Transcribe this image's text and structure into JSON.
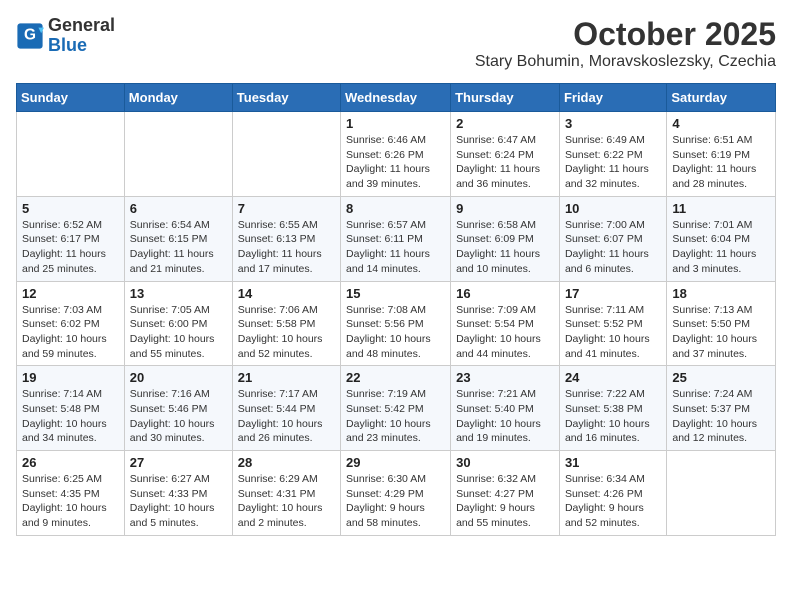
{
  "header": {
    "logo_general": "General",
    "logo_blue": "Blue",
    "title": "October 2025",
    "subtitle": "Stary Bohumin, Moravskoslezsky, Czechia"
  },
  "weekdays": [
    "Sunday",
    "Monday",
    "Tuesday",
    "Wednesday",
    "Thursday",
    "Friday",
    "Saturday"
  ],
  "weeks": [
    [
      {
        "day": "",
        "info": ""
      },
      {
        "day": "",
        "info": ""
      },
      {
        "day": "",
        "info": ""
      },
      {
        "day": "1",
        "info": "Sunrise: 6:46 AM\nSunset: 6:26 PM\nDaylight: 11 hours\nand 39 minutes."
      },
      {
        "day": "2",
        "info": "Sunrise: 6:47 AM\nSunset: 6:24 PM\nDaylight: 11 hours\nand 36 minutes."
      },
      {
        "day": "3",
        "info": "Sunrise: 6:49 AM\nSunset: 6:22 PM\nDaylight: 11 hours\nand 32 minutes."
      },
      {
        "day": "4",
        "info": "Sunrise: 6:51 AM\nSunset: 6:19 PM\nDaylight: 11 hours\nand 28 minutes."
      }
    ],
    [
      {
        "day": "5",
        "info": "Sunrise: 6:52 AM\nSunset: 6:17 PM\nDaylight: 11 hours\nand 25 minutes."
      },
      {
        "day": "6",
        "info": "Sunrise: 6:54 AM\nSunset: 6:15 PM\nDaylight: 11 hours\nand 21 minutes."
      },
      {
        "day": "7",
        "info": "Sunrise: 6:55 AM\nSunset: 6:13 PM\nDaylight: 11 hours\nand 17 minutes."
      },
      {
        "day": "8",
        "info": "Sunrise: 6:57 AM\nSunset: 6:11 PM\nDaylight: 11 hours\nand 14 minutes."
      },
      {
        "day": "9",
        "info": "Sunrise: 6:58 AM\nSunset: 6:09 PM\nDaylight: 11 hours\nand 10 minutes."
      },
      {
        "day": "10",
        "info": "Sunrise: 7:00 AM\nSunset: 6:07 PM\nDaylight: 11 hours\nand 6 minutes."
      },
      {
        "day": "11",
        "info": "Sunrise: 7:01 AM\nSunset: 6:04 PM\nDaylight: 11 hours\nand 3 minutes."
      }
    ],
    [
      {
        "day": "12",
        "info": "Sunrise: 7:03 AM\nSunset: 6:02 PM\nDaylight: 10 hours\nand 59 minutes."
      },
      {
        "day": "13",
        "info": "Sunrise: 7:05 AM\nSunset: 6:00 PM\nDaylight: 10 hours\nand 55 minutes."
      },
      {
        "day": "14",
        "info": "Sunrise: 7:06 AM\nSunset: 5:58 PM\nDaylight: 10 hours\nand 52 minutes."
      },
      {
        "day": "15",
        "info": "Sunrise: 7:08 AM\nSunset: 5:56 PM\nDaylight: 10 hours\nand 48 minutes."
      },
      {
        "day": "16",
        "info": "Sunrise: 7:09 AM\nSunset: 5:54 PM\nDaylight: 10 hours\nand 44 minutes."
      },
      {
        "day": "17",
        "info": "Sunrise: 7:11 AM\nSunset: 5:52 PM\nDaylight: 10 hours\nand 41 minutes."
      },
      {
        "day": "18",
        "info": "Sunrise: 7:13 AM\nSunset: 5:50 PM\nDaylight: 10 hours\nand 37 minutes."
      }
    ],
    [
      {
        "day": "19",
        "info": "Sunrise: 7:14 AM\nSunset: 5:48 PM\nDaylight: 10 hours\nand 34 minutes."
      },
      {
        "day": "20",
        "info": "Sunrise: 7:16 AM\nSunset: 5:46 PM\nDaylight: 10 hours\nand 30 minutes."
      },
      {
        "day": "21",
        "info": "Sunrise: 7:17 AM\nSunset: 5:44 PM\nDaylight: 10 hours\nand 26 minutes."
      },
      {
        "day": "22",
        "info": "Sunrise: 7:19 AM\nSunset: 5:42 PM\nDaylight: 10 hours\nand 23 minutes."
      },
      {
        "day": "23",
        "info": "Sunrise: 7:21 AM\nSunset: 5:40 PM\nDaylight: 10 hours\nand 19 minutes."
      },
      {
        "day": "24",
        "info": "Sunrise: 7:22 AM\nSunset: 5:38 PM\nDaylight: 10 hours\nand 16 minutes."
      },
      {
        "day": "25",
        "info": "Sunrise: 7:24 AM\nSunset: 5:37 PM\nDaylight: 10 hours\nand 12 minutes."
      }
    ],
    [
      {
        "day": "26",
        "info": "Sunrise: 6:25 AM\nSunset: 4:35 PM\nDaylight: 10 hours\nand 9 minutes."
      },
      {
        "day": "27",
        "info": "Sunrise: 6:27 AM\nSunset: 4:33 PM\nDaylight: 10 hours\nand 5 minutes."
      },
      {
        "day": "28",
        "info": "Sunrise: 6:29 AM\nSunset: 4:31 PM\nDaylight: 10 hours\nand 2 minutes."
      },
      {
        "day": "29",
        "info": "Sunrise: 6:30 AM\nSunset: 4:29 PM\nDaylight: 9 hours\nand 58 minutes."
      },
      {
        "day": "30",
        "info": "Sunrise: 6:32 AM\nSunset: 4:27 PM\nDaylight: 9 hours\nand 55 minutes."
      },
      {
        "day": "31",
        "info": "Sunrise: 6:34 AM\nSunset: 4:26 PM\nDaylight: 9 hours\nand 52 minutes."
      },
      {
        "day": "",
        "info": ""
      }
    ]
  ]
}
